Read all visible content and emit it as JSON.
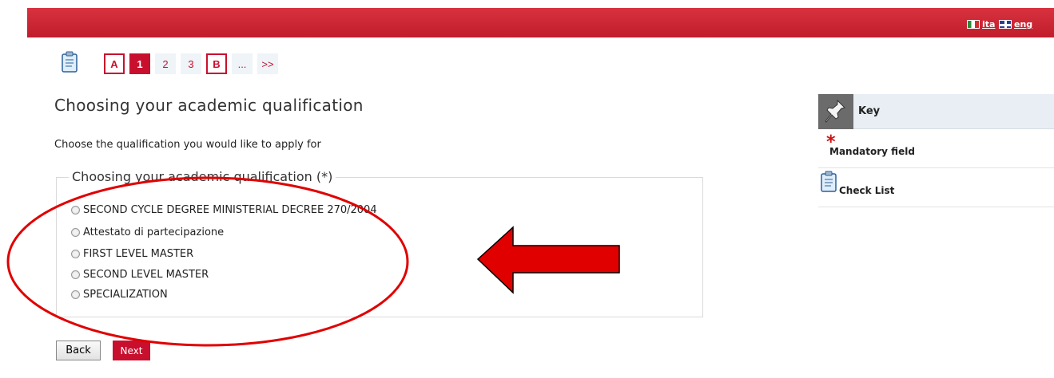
{
  "header": {
    "lang_it": "ita",
    "lang_en": "eng"
  },
  "steps": [
    "A",
    "1",
    "2",
    "3",
    "B",
    "...",
    ">>"
  ],
  "page": {
    "title": "Choosing your academic qualification",
    "subtitle": "Choose the qualification you would like to apply for"
  },
  "form": {
    "legend": "Choosing your academic qualification (*)",
    "options": [
      "SECOND CYCLE DEGREE MINISTERIAL DECREE 270/2004",
      "Attestato di partecipazione",
      "FIRST LEVEL MASTER",
      "SECOND LEVEL MASTER",
      "SPECIALIZATION"
    ]
  },
  "buttons": {
    "back": "Back",
    "next": "Next"
  },
  "key": {
    "title": "Key",
    "mandatory": "Mandatory field",
    "mandatory_symbol": "*",
    "checklist": "Check List"
  },
  "colors": {
    "brand_red": "#c8102e",
    "annotation_red": "#e00000"
  }
}
